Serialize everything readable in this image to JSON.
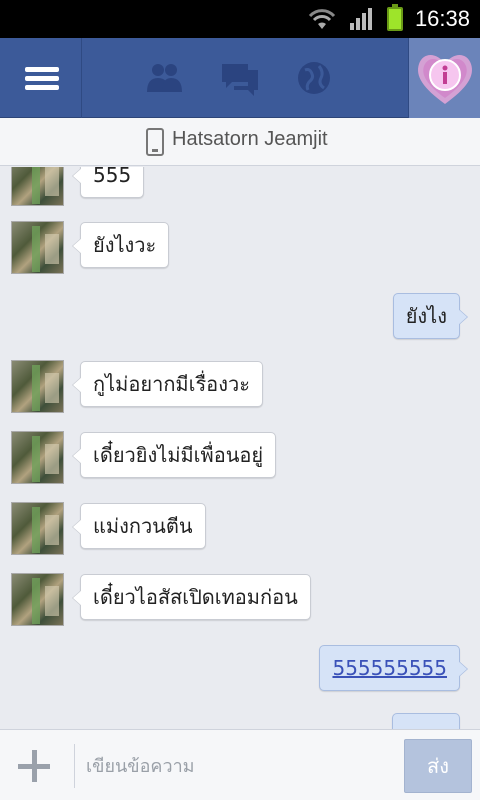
{
  "status_bar": {
    "time": "16:38"
  },
  "header": {
    "icons": [
      "menu-icon",
      "friend-requests-icon",
      "messages-icon",
      "notifications-globe-icon",
      "profile-info-icon"
    ]
  },
  "conversation_header": {
    "title": "Hatsatorn Jeamjit",
    "icon": "mobile-phone-icon"
  },
  "messages": [
    {
      "direction": "in",
      "text": "555"
    },
    {
      "direction": "in",
      "text": "ยังไงวะ"
    },
    {
      "direction": "out",
      "text": "ยังไง"
    },
    {
      "direction": "in",
      "text": "กูไม่อยากมีเรื่องวะ"
    },
    {
      "direction": "in",
      "text": "เดี๋ยวยิงไม่มีเพื่อนอยู่"
    },
    {
      "direction": "in",
      "text": "แม่งกวนตีน"
    },
    {
      "direction": "in",
      "text": "เดี๋ยวไอสัสเปิดเทอมก่อน"
    },
    {
      "direction": "out",
      "text": "555555555",
      "link": true
    },
    {
      "direction": "out",
      "text": "",
      "partial": true
    }
  ],
  "composer": {
    "placeholder": "เขียนข้อความ",
    "send_label": "ส่ง"
  },
  "colors": {
    "header_bg": "#3c5a99",
    "incoming_bubble": "#ffffff",
    "outgoing_bubble": "#d6e3f7",
    "conversation_bg": "#e9ebf0",
    "send_button": "#b4c3dd"
  }
}
